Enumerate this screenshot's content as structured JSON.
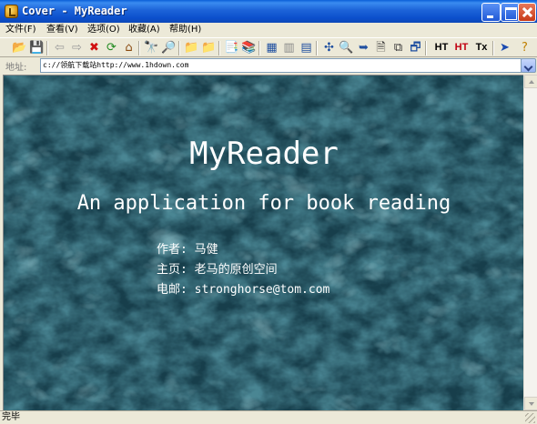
{
  "window": {
    "title": "Cover - MyReader"
  },
  "menu": {
    "items": [
      "文件(F)",
      "查看(V)",
      "选项(O)",
      "收藏(A)",
      "帮助(H)"
    ]
  },
  "toolbar": {
    "tools": [
      {
        "name": "open-icon",
        "glyph": "📂"
      },
      {
        "name": "save-icon",
        "glyph": "💾"
      },
      {
        "name": "back-icon",
        "glyph": "⇦"
      },
      {
        "name": "forward-icon",
        "glyph": "⇨"
      },
      {
        "name": "stop-icon",
        "glyph": "✖"
      },
      {
        "name": "refresh-icon",
        "glyph": "⟳"
      },
      {
        "name": "home-icon",
        "glyph": "⌂"
      },
      {
        "name": "find-icon",
        "glyph": "🔭"
      },
      {
        "name": "search-web-icon",
        "glyph": "🔎"
      },
      {
        "name": "folder-icon",
        "glyph": "📁"
      },
      {
        "name": "folder-up-icon",
        "glyph": "📁"
      },
      {
        "name": "bookmark-icon",
        "glyph": "📑"
      },
      {
        "name": "bookmark-list-icon",
        "glyph": "📚"
      },
      {
        "name": "table-icon",
        "glyph": "▦"
      },
      {
        "name": "panel-icon",
        "glyph": "▥"
      },
      {
        "name": "layout-icon",
        "glyph": "▤"
      },
      {
        "name": "split-icon",
        "glyph": "✣"
      },
      {
        "name": "zoom-icon",
        "glyph": "🔍"
      },
      {
        "name": "goto-icon",
        "glyph": "➥"
      },
      {
        "name": "page-icon",
        "glyph": "🗎"
      },
      {
        "name": "copy-icon",
        "glyph": "⧉"
      },
      {
        "name": "window-icon",
        "glyph": "🗗"
      }
    ],
    "text_tools": [
      "HT",
      "HT",
      "Tx"
    ],
    "end_tools": [
      {
        "name": "cursor-icon",
        "glyph": "➤"
      },
      {
        "name": "help-icon",
        "glyph": "?"
      },
      {
        "name": "exit-icon",
        "glyph": "⏏"
      }
    ]
  },
  "address": {
    "label": "地址:",
    "value": "c://领航下载站http://www.1hdown.com"
  },
  "document": {
    "title": "MyReader",
    "subtitle": "An application for book reading",
    "author_label": "作者:",
    "author_value": "马健",
    "homepage_label": "主页:",
    "homepage_value": "老马的原创空间",
    "email_label": "电邮:",
    "email_value": "stronghorse@tom.com"
  },
  "status": {
    "text": "完毕"
  },
  "colors": {
    "background_teal": "#1f4d5c",
    "title_bar_blue": "#0b4fcc",
    "window_face": "#ece9d8"
  }
}
